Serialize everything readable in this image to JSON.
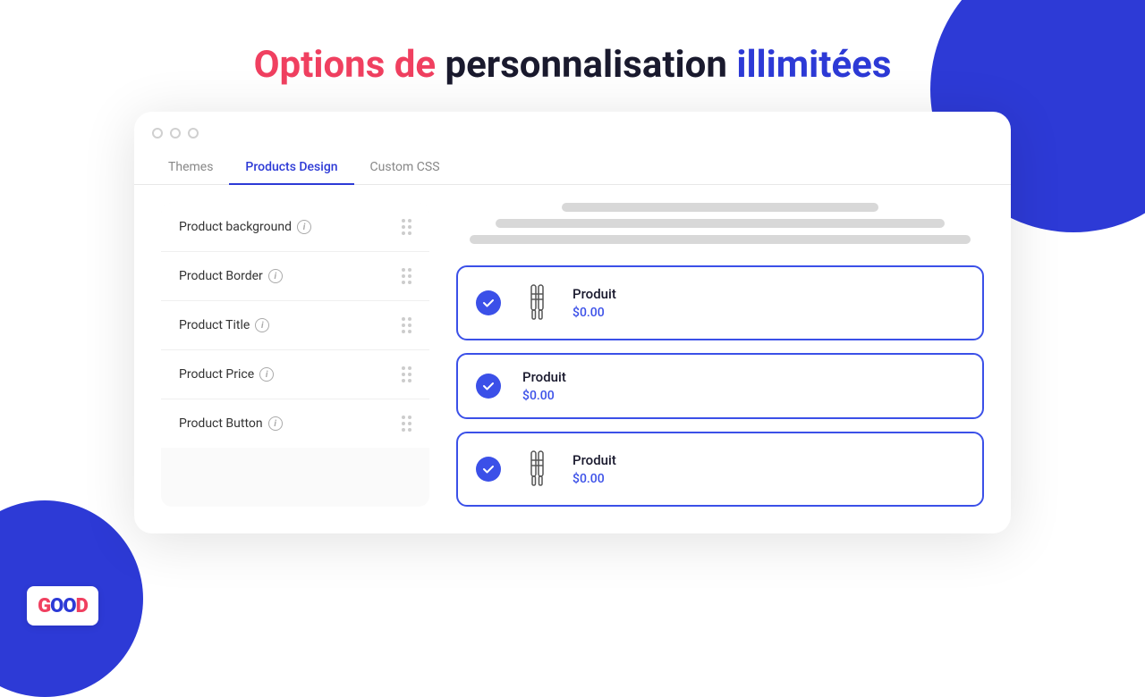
{
  "page": {
    "title_part1": "Options de ",
    "title_part2": "personnalisation",
    "title_part3": " illimitées"
  },
  "tabs": {
    "themes": "Themes",
    "products_design": "Products Design",
    "custom_css": "Custom CSS",
    "active": "products_design"
  },
  "settings": {
    "rows": [
      {
        "label": "Product background",
        "has_info": true
      },
      {
        "label": "Product Border",
        "has_info": true
      },
      {
        "label": "Product Title",
        "has_info": true
      },
      {
        "label": "Product Price",
        "has_info": true
      },
      {
        "label": "Product Button",
        "has_info": true
      }
    ]
  },
  "products": [
    {
      "title": "Produit",
      "price": "$0.00",
      "has_image": true
    },
    {
      "title": "Produit",
      "price": "$0.00",
      "has_image": false
    },
    {
      "title": "Produit",
      "price": "$0.00",
      "has_image": true
    }
  ],
  "logo": "GOOD"
}
